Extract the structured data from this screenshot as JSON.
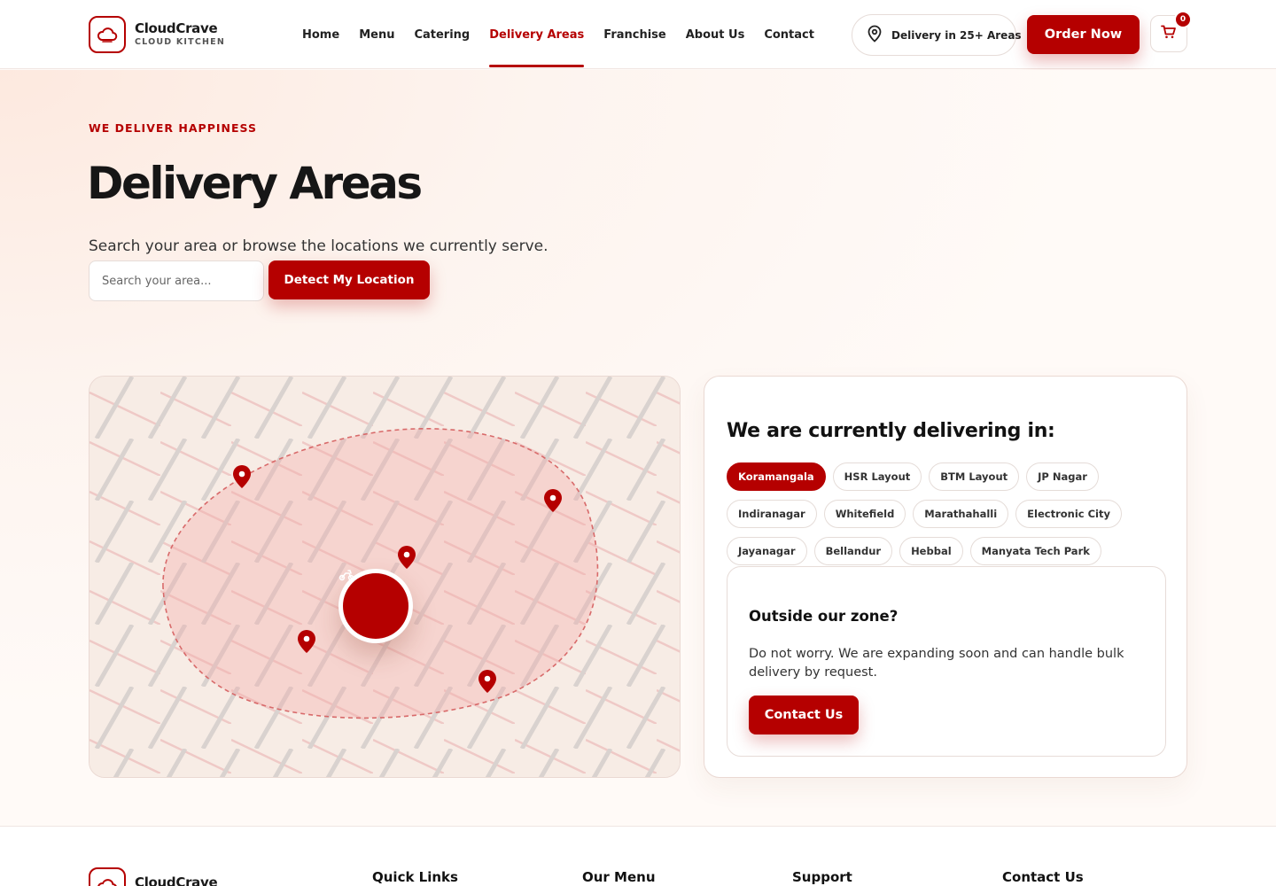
{
  "brand": {
    "name": "CloudCrave",
    "tagline": "CLOUD KITCHEN",
    "accent_color": "#b50000"
  },
  "nav": {
    "items": [
      {
        "label": "Home",
        "active": false
      },
      {
        "label": "Menu",
        "active": false
      },
      {
        "label": "Catering",
        "active": false
      },
      {
        "label": "Delivery Areas",
        "active": true
      },
      {
        "label": "Franchise",
        "active": false
      },
      {
        "label": "About Us",
        "active": false
      },
      {
        "label": "Contact",
        "active": false
      }
    ],
    "delivery_pill": "Delivery in 25+ Areas",
    "order_button": "Order Now",
    "cart_count": "0"
  },
  "hero": {
    "eyebrow": "WE DELIVER HAPPINESS",
    "title": "Delivery Areas",
    "lead": "Search your area or browse the locations we currently serve.",
    "search_placeholder": "Search your area...",
    "detect_button": "Detect My Location"
  },
  "map": {
    "center_icon": "scooter-icon",
    "pin_icon": "location-pin-icon",
    "pin_count": 5
  },
  "areas": {
    "title": "We are currently delivering in:",
    "chips": [
      [
        "Koramangala",
        "HSR Layout",
        "BTM Layout",
        "JP Nagar"
      ],
      [
        "Indiranagar",
        "Whitefield",
        "Marathahalli",
        "Electronic City"
      ],
      [
        "Jayanagar",
        "Bellandur",
        "Hebbal",
        "Manyata Tech Park"
      ]
    ],
    "selected": "Koramangala"
  },
  "zone": {
    "title": "Outside our zone?",
    "text": "Do not worry. We are expanding soon and can handle bulk delivery by request.",
    "button": "Contact Us"
  },
  "footer": {
    "brand": "CloudCrave",
    "columns": [
      "Quick Links",
      "Our Menu",
      "Support",
      "Contact Us"
    ]
  }
}
